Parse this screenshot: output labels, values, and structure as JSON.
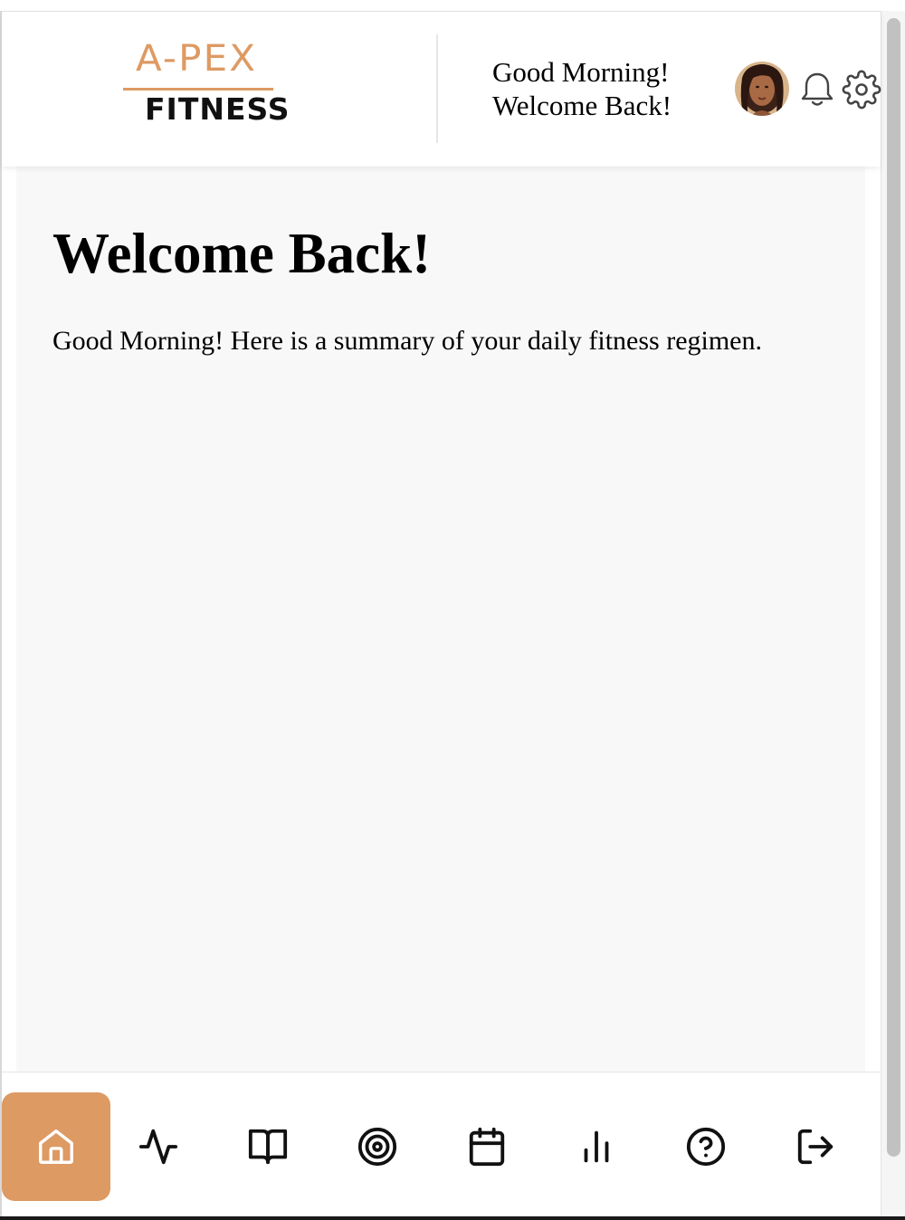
{
  "header": {
    "logo_top": "A-PEX",
    "logo_bottom": "FITNESS",
    "greeting_line1": "Good Morning!",
    "greeting_line2": "Welcome Back!"
  },
  "main": {
    "title": "Welcome Back!",
    "summary": "Good Morning! Here is a summary of your daily fitness regimen."
  },
  "nav": {
    "items": [
      {
        "icon": "home-icon",
        "active": true
      },
      {
        "icon": "activity-icon",
        "active": false
      },
      {
        "icon": "book-icon",
        "active": false
      },
      {
        "icon": "target-icon",
        "active": false
      },
      {
        "icon": "calendar-icon",
        "active": false
      },
      {
        "icon": "bar-chart-icon",
        "active": false
      },
      {
        "icon": "help-icon",
        "active": false
      },
      {
        "icon": "logout-icon",
        "active": false
      }
    ]
  },
  "colors": {
    "accent": "#dd9a63",
    "main_bg": "#f8f8f8",
    "text": "#000000"
  }
}
